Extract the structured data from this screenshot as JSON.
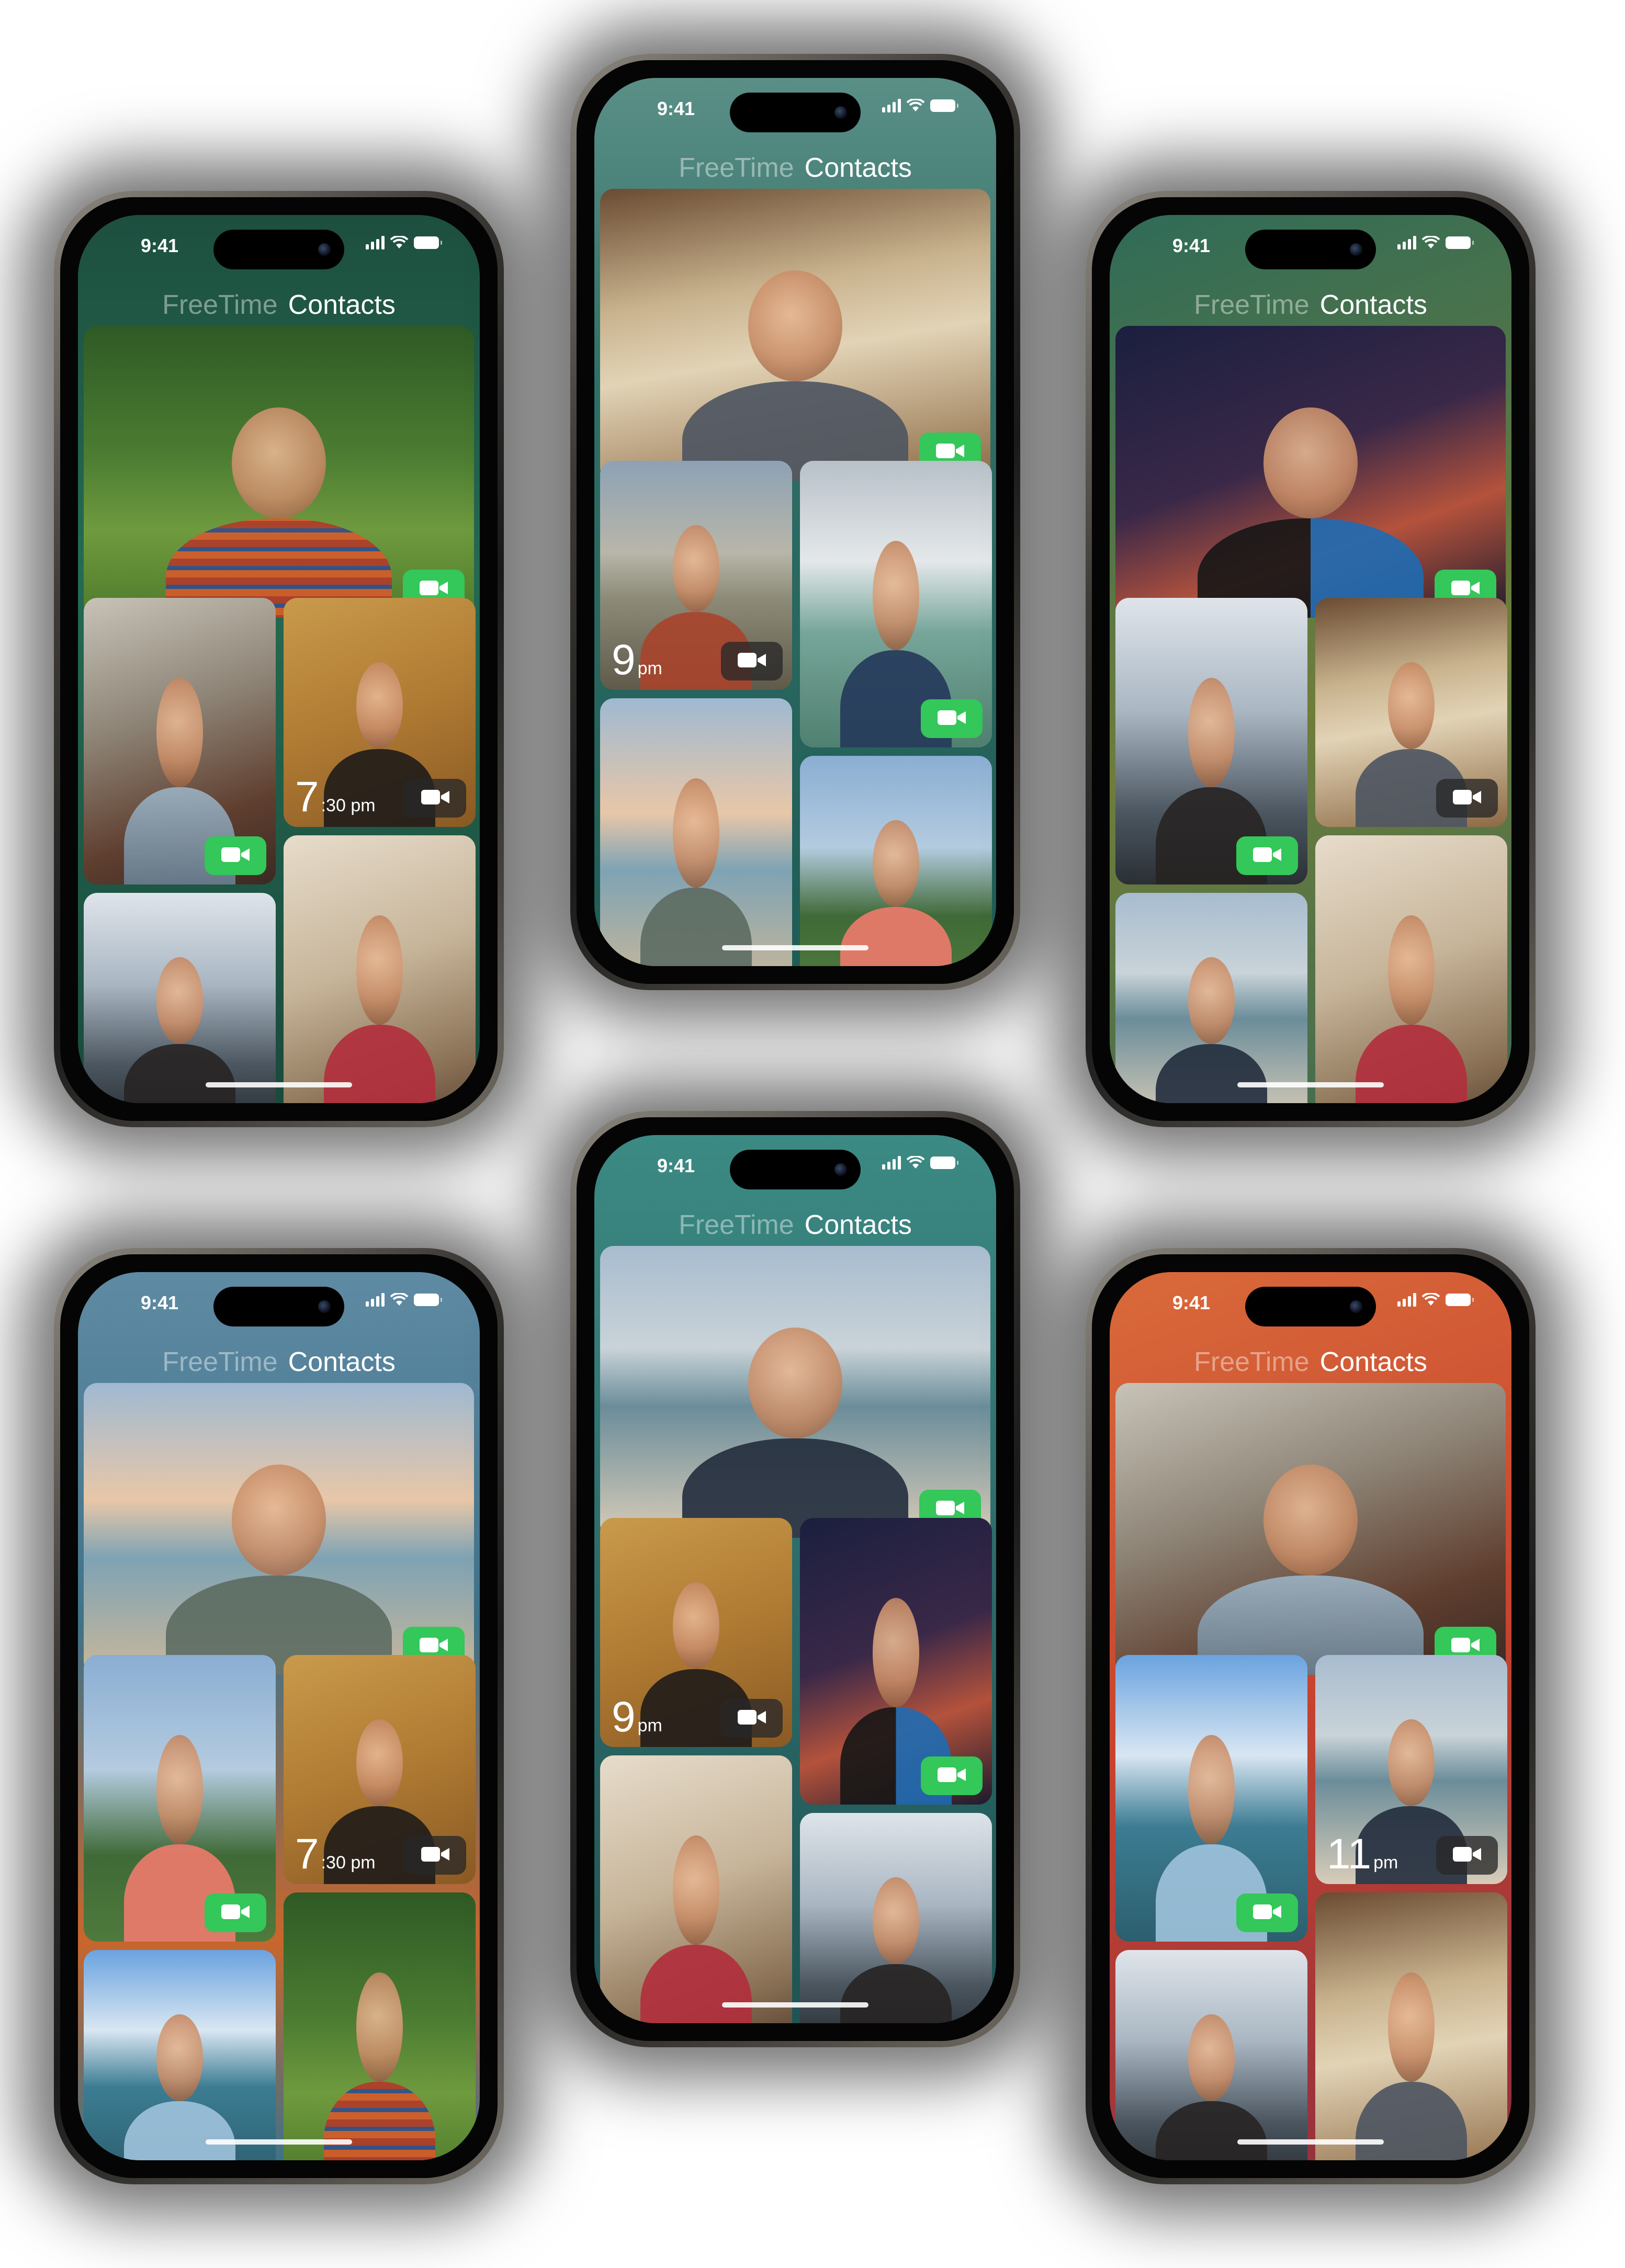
{
  "status": {
    "time": "9:41"
  },
  "header": {
    "tab_freetime": "FreeTime",
    "tab_contacts": "Contacts"
  },
  "icons": {
    "facetime_button": "video-camera-icon",
    "signal": "cellular-signal-icon",
    "wifi": "wifi-icon",
    "battery": "battery-icon"
  },
  "colors": {
    "facetime_green": "#34c759",
    "unavailable_gray": "#282828",
    "phone_backgrounds": [
      "#1f5a45",
      "#2f6e66",
      "#6f7d3a",
      "#3f7289",
      "#2c6b6a",
      "#c8452f"
    ]
  },
  "phones": [
    {
      "name": "phone-top-left",
      "tiles": [
        {
          "photo": "boy",
          "button": "green"
        },
        {
          "photo": "sunflower",
          "button": "green"
        },
        {
          "photo": "gold",
          "button": "gray",
          "local_time": "7",
          "local_time_suffix": ":30 pm"
        },
        {
          "photo": "arch"
        },
        {
          "photo": "room"
        }
      ]
    },
    {
      "name": "phone-top-center",
      "tiles": [
        {
          "photo": "cafe",
          "button": "green"
        },
        {
          "photo": "coast",
          "button": "gray",
          "local_time": "9",
          "local_time_suffix": "pm"
        },
        {
          "photo": "cloud",
          "button": "green"
        },
        {
          "photo": "beach"
        },
        {
          "photo": "field"
        }
      ]
    },
    {
      "name": "phone-top-right",
      "tiles": [
        {
          "photo": "party",
          "button": "green"
        },
        {
          "photo": "arch",
          "button": "green"
        },
        {
          "photo": "cafe",
          "button": "gray"
        },
        {
          "photo": "shore"
        },
        {
          "photo": "room"
        }
      ]
    },
    {
      "name": "phone-bottom-left",
      "tiles": [
        {
          "photo": "beach",
          "button": "green"
        },
        {
          "photo": "field",
          "button": "green"
        },
        {
          "photo": "gold",
          "button": "gray",
          "local_time": "7",
          "local_time_suffix": ":30 pm"
        },
        {
          "photo": "lake"
        },
        {
          "photo": "boy"
        }
      ]
    },
    {
      "name": "phone-bottom-center",
      "tiles": [
        {
          "photo": "shore",
          "button": "green"
        },
        {
          "photo": "gold",
          "button": "gray",
          "local_time": "9",
          "local_time_suffix": "pm"
        },
        {
          "photo": "party",
          "button": "green"
        },
        {
          "photo": "room"
        },
        {
          "photo": "arch"
        }
      ]
    },
    {
      "name": "phone-bottom-right",
      "tiles": [
        {
          "photo": "sunflower",
          "button": "green"
        },
        {
          "photo": "lake",
          "button": "green"
        },
        {
          "photo": "shore",
          "button": "gray",
          "local_time": "11",
          "local_time_suffix": "pm"
        },
        {
          "photo": "arch"
        },
        {
          "photo": "cafe"
        }
      ]
    }
  ]
}
